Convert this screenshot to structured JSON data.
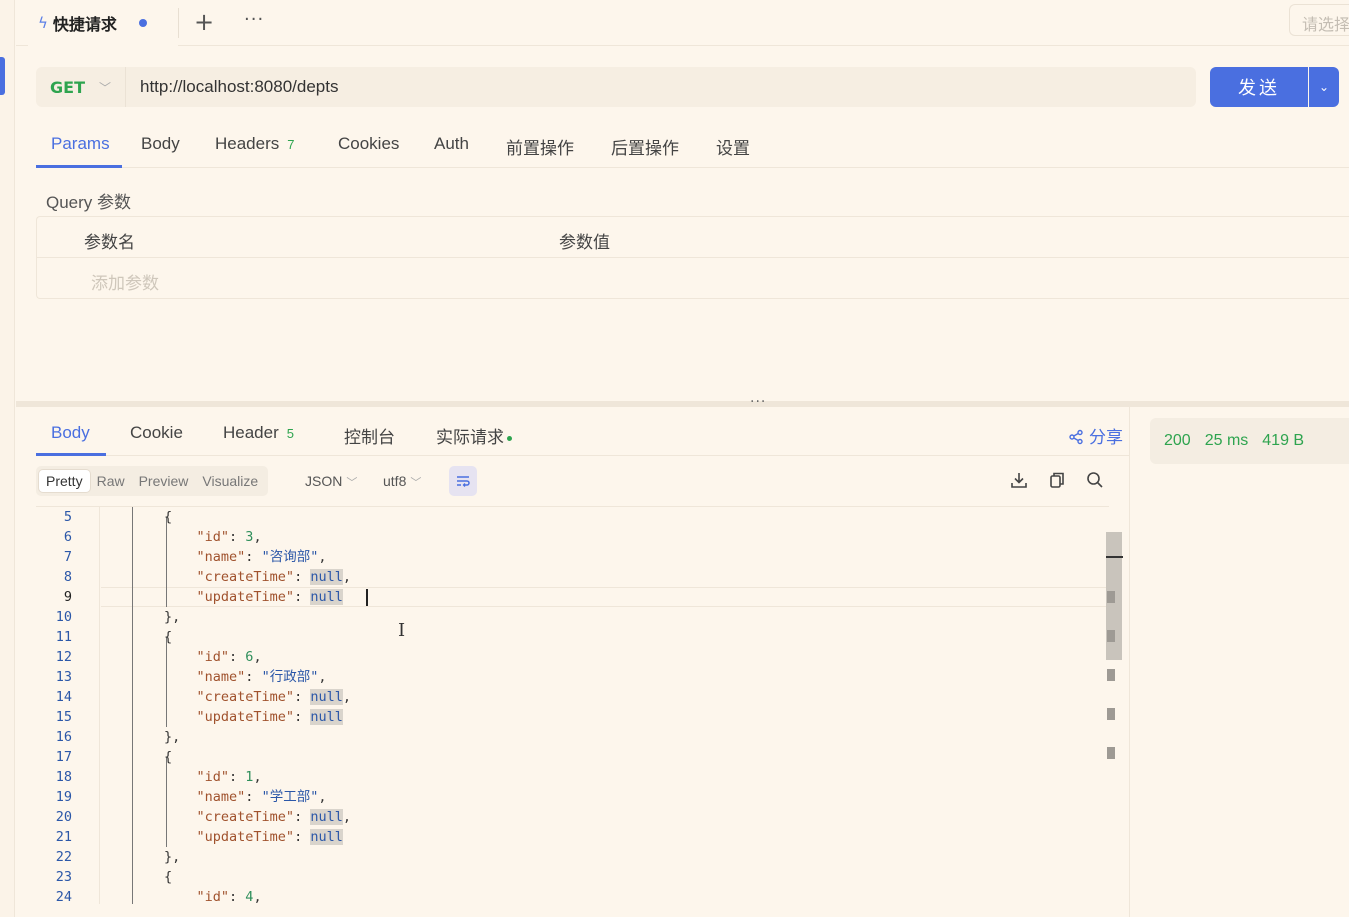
{
  "tabbar": {
    "active_tab": "快捷请求",
    "plus": "+",
    "more": "···",
    "env_placeholder": "请选择"
  },
  "request": {
    "method": "GET",
    "url": "http://localhost:8080/depts",
    "send_label": "发送"
  },
  "req_tabs": [
    {
      "label": "Params"
    },
    {
      "label": "Body"
    },
    {
      "label": "Headers",
      "count": "7"
    },
    {
      "label": "Cookies"
    },
    {
      "label": "Auth"
    },
    {
      "label": "前置操作"
    },
    {
      "label": "后置操作"
    },
    {
      "label": "设置"
    }
  ],
  "params": {
    "section_label": "Query 参数",
    "col_name": "参数名",
    "col_value": "参数值",
    "add_placeholder": "添加参数"
  },
  "resp_tabs": [
    {
      "label": "Body"
    },
    {
      "label": "Cookie"
    },
    {
      "label": "Header",
      "count": "5"
    },
    {
      "label": "控制台"
    },
    {
      "label": "实际请求"
    }
  ],
  "share_label": "分享",
  "status": {
    "code": "200",
    "time": "25 ms",
    "size": "419 B"
  },
  "format": {
    "modes": [
      "Pretty",
      "Raw",
      "Preview",
      "Visualize"
    ],
    "lang": "JSON",
    "encoding": "utf8"
  },
  "code": {
    "line_numbers": [
      "5",
      "6",
      "7",
      "8",
      "9",
      "10",
      "11",
      "12",
      "13",
      "14",
      "15",
      "16",
      "17",
      "18",
      "19",
      "20",
      "21",
      "22",
      "23",
      "24"
    ],
    "depts": [
      {
        "id": "3",
        "name": "\"咨询部\""
      },
      {
        "id": "6",
        "name": "\"行政部\""
      },
      {
        "id": "1",
        "name": "\"学工部\""
      },
      {
        "id": "4"
      }
    ],
    "keys": {
      "id": "\"id\"",
      "name": "\"name\"",
      "createTime": "\"createTime\"",
      "updateTime": "\"updateTime\""
    },
    "null_value": "null"
  },
  "colors": {
    "accent": "#4a6fe0",
    "success": "#2ea44f",
    "background": "#fdf6ec"
  }
}
